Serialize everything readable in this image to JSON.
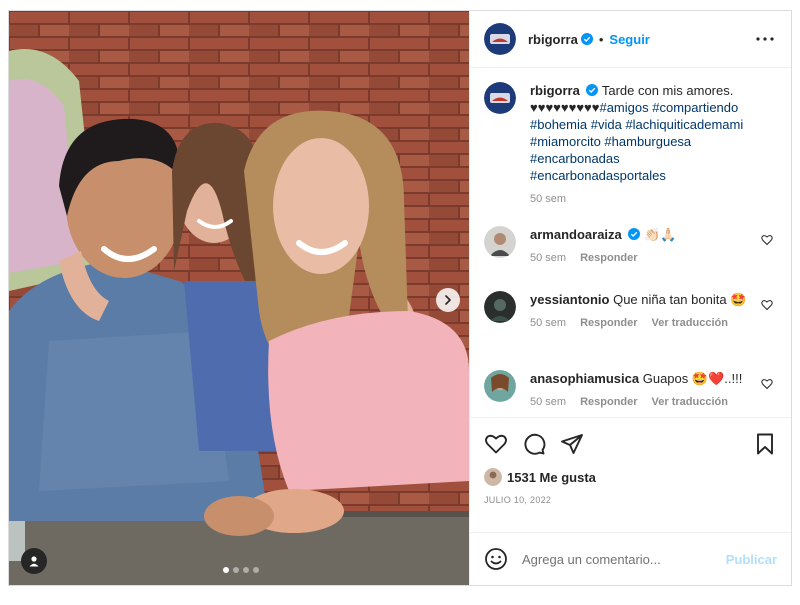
{
  "post": {
    "username": "rbigorra",
    "follow_label": "Seguir",
    "separator": "•",
    "more_icon": "more-horizontal-icon",
    "carousel": {
      "current_slide": 1,
      "total_slides": 4,
      "next_icon": "chevron-right-icon",
      "tag_icon": "user-tag-icon"
    }
  },
  "caption": {
    "username": "rbigorra",
    "text_plain": "Tarde con mis amores. ♥♥♥♥♥♥♥♥♥",
    "hashtags": [
      "#amigos",
      "#compartiendo",
      "#bohemia",
      "#vida",
      "#lachiquiticademami",
      "#miamorcito",
      "#hamburguesa",
      "#encarbonadas",
      "#encarbonadasportales"
    ],
    "time": "50 sem"
  },
  "comments": [
    {
      "username": "armandoaraiza",
      "verified": true,
      "text": "👏🏻🙏🏻",
      "time": "50 sem",
      "reply": "Responder",
      "translate": ""
    },
    {
      "username": "yessiantonio",
      "verified": false,
      "text": "Que niña tan bonita 🤩",
      "time": "50 sem",
      "reply": "Responder",
      "translate": "Ver traducción"
    },
    {
      "username": "anasophiamusica",
      "verified": false,
      "text": "Guapos 🤩❤️..!!!",
      "time": "50 sem",
      "reply": "Responder",
      "translate": "Ver traducción"
    }
  ],
  "actions": {
    "icons": [
      "heart-icon",
      "comment-icon",
      "share-icon",
      "bookmark-icon"
    ],
    "likes_text": "1531 Me gusta",
    "date": "JULIO 10, 2022"
  },
  "composer": {
    "placeholder": "Agrega un comentario...",
    "publish_label": "Publicar",
    "emoji_icon": "emoji-icon"
  },
  "colors": {
    "accent": "#0095f6",
    "publish_disabled": "#b2dffc",
    "hashtag": "#00376b",
    "muted": "#8e8e8e",
    "text": "#262626",
    "border": "#efefef"
  }
}
